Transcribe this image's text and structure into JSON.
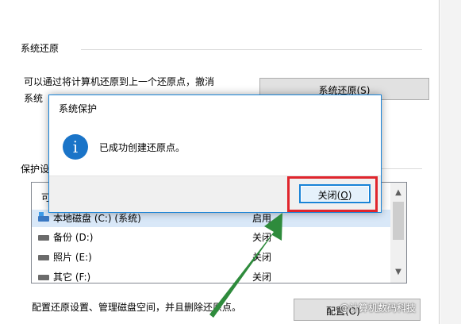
{
  "restore_section": {
    "title": "系统还原",
    "description_line1": "可以通过将计算机还原到上一个还原点，撤消",
    "description_line2": "系统",
    "restore_button": "系统还原(S)"
  },
  "protection_section": {
    "title": "保护设",
    "list_header": "可",
    "drives": [
      {
        "name": "本地磁盘 (C:) (系统)",
        "status": "启用"
      },
      {
        "name": "备份 (D:)",
        "status": "关闭"
      },
      {
        "name": "照片 (E:)",
        "status": "关闭"
      },
      {
        "name": "其它 (F:)",
        "status": "关闭"
      }
    ],
    "config_description": "配置还原设置、管理磁盘空间，并且删除还原点。",
    "config_button": "配置(O)"
  },
  "dialog": {
    "title": "系统保护",
    "message": "已成功创建还原点。",
    "close_button_text": "关闭(",
    "close_button_key": "O",
    "close_button_end": ")"
  },
  "watermark": "@计算机数码科技",
  "colors": {
    "accent": "#1883d7",
    "highlight": "#e0252c",
    "arrow": "#2e8b3c",
    "info_icon": "#1a74c8"
  },
  "icons": {
    "dialog": "info-icon",
    "drive": "drive-icon",
    "system_drive": "system-drive-icon"
  }
}
